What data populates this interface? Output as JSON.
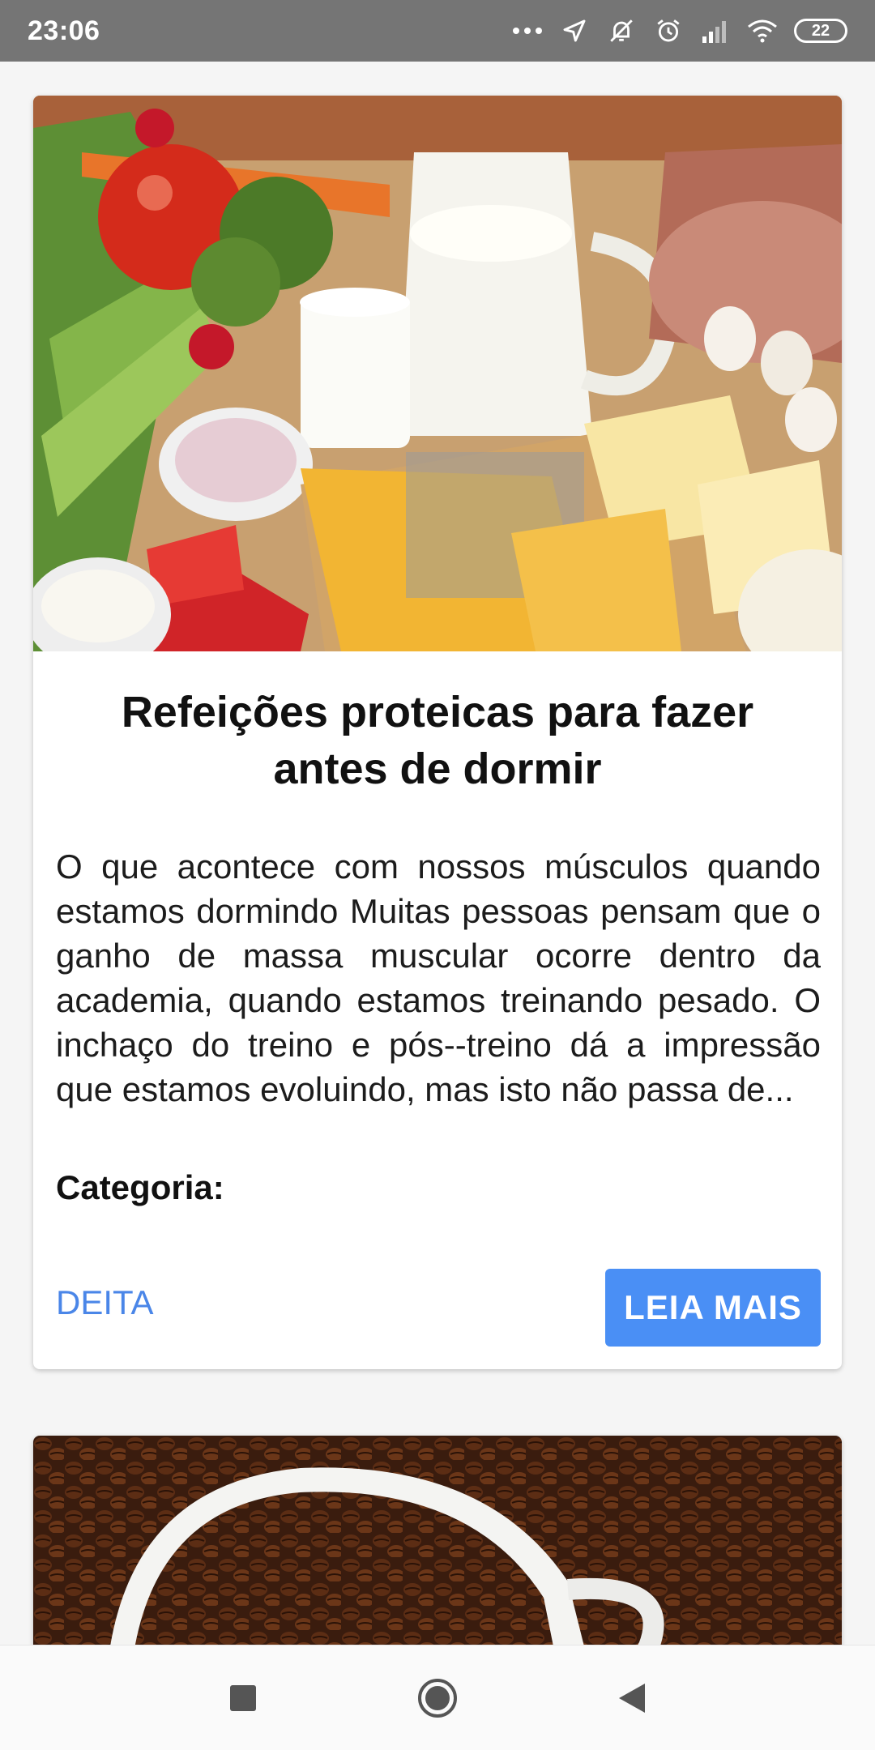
{
  "status_bar": {
    "time": "23:06",
    "battery": "22",
    "icons": [
      "more-dots-icon",
      "location-arrow-icon",
      "mute-bell-icon",
      "alarm-icon",
      "signal-icon",
      "wifi-icon",
      "battery-icon"
    ]
  },
  "cards": [
    {
      "image": "food-protein-image",
      "title": "Refeições proteicas para fazer antes de dormir",
      "excerpt": "O que acontece com nossos músculos quando estamos dormindo Muitas pessoas pensam que o ganho de massa muscular ocorre dentro da academia, quando estamos treinando pesado. O inchaço do treino e pós--treino dá a impressão que estamos evoluindo, mas isto não passa de...",
      "category_label": "Categoria:",
      "category_value": "DEITA",
      "button_label": "LEIA MAIS"
    },
    {
      "image": "coffee-beans-image"
    }
  ],
  "nav_bar": {
    "icons": [
      "recent-apps-icon",
      "home-icon",
      "back-icon"
    ]
  },
  "colors": {
    "status_bar": "#757575",
    "accent": "#4a8ff5",
    "link": "#4a86e8",
    "background": "#f5f5f5"
  }
}
